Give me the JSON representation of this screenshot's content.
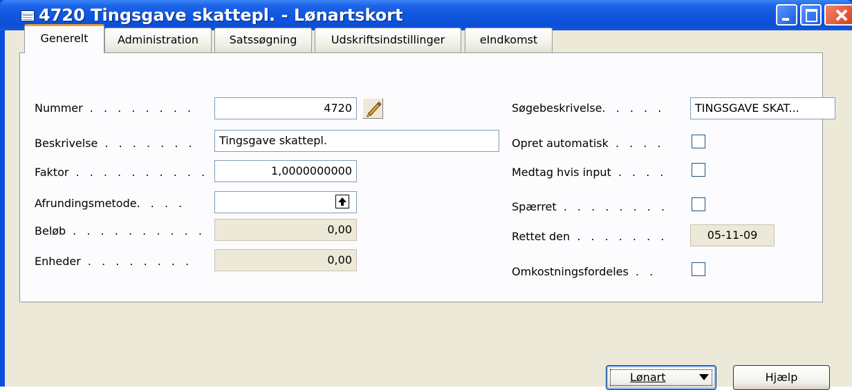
{
  "window": {
    "title": "4720 Tingsgave skattepl. - Lønartskort",
    "icon": "table-icon",
    "controls": [
      "minimize-icon",
      "maximize-icon",
      "close-icon"
    ]
  },
  "tabs": [
    {
      "label": "Generelt",
      "active": true
    },
    {
      "label": "Administration",
      "active": false
    },
    {
      "label": "Satssøgning",
      "active": false
    },
    {
      "label": "Udskriftsindstillinger",
      "active": false
    },
    {
      "label": "eIndkomst",
      "active": false
    }
  ],
  "left_fields": {
    "nummer": {
      "label": "Nummer",
      "value": "4720"
    },
    "beskrivelse": {
      "label": "Beskrivelse",
      "value": "Tingsgave skattepl."
    },
    "faktor": {
      "label": "Faktor",
      "value": "1,0000000000"
    },
    "afrundingsmetode": {
      "label": "Afrundingsmetode",
      "value": ""
    },
    "beloeb": {
      "label": "Beløb",
      "value": "0,00"
    },
    "enheder": {
      "label": "Enheder",
      "value": "0,00"
    }
  },
  "right_fields": {
    "soegebeskrivelse": {
      "label": "Søgebeskrivelse",
      "value": "TINGSGAVE SKAT..."
    },
    "opret_automatisk": {
      "label": "Opret automatisk",
      "checked": false
    },
    "medtag_hvis_input": {
      "label": "Medtag hvis input",
      "checked": false
    },
    "spaerret": {
      "label": "Spærret",
      "checked": false
    },
    "rettet_den": {
      "label": "Rettet den",
      "value": "05-11-09"
    },
    "omkostningsfordeles": {
      "label": "Omkostningsfordeles",
      "checked": false
    }
  },
  "buttons": {
    "loenart": {
      "label": "Lønart",
      "icon": "dropdown-arrow-icon"
    },
    "hjaelp": {
      "label": "Hjælp"
    }
  },
  "colors": {
    "titlebar": "#0f56df",
    "dialog_bg": "#ece9d8",
    "tab_highlight": "#f0a030"
  }
}
